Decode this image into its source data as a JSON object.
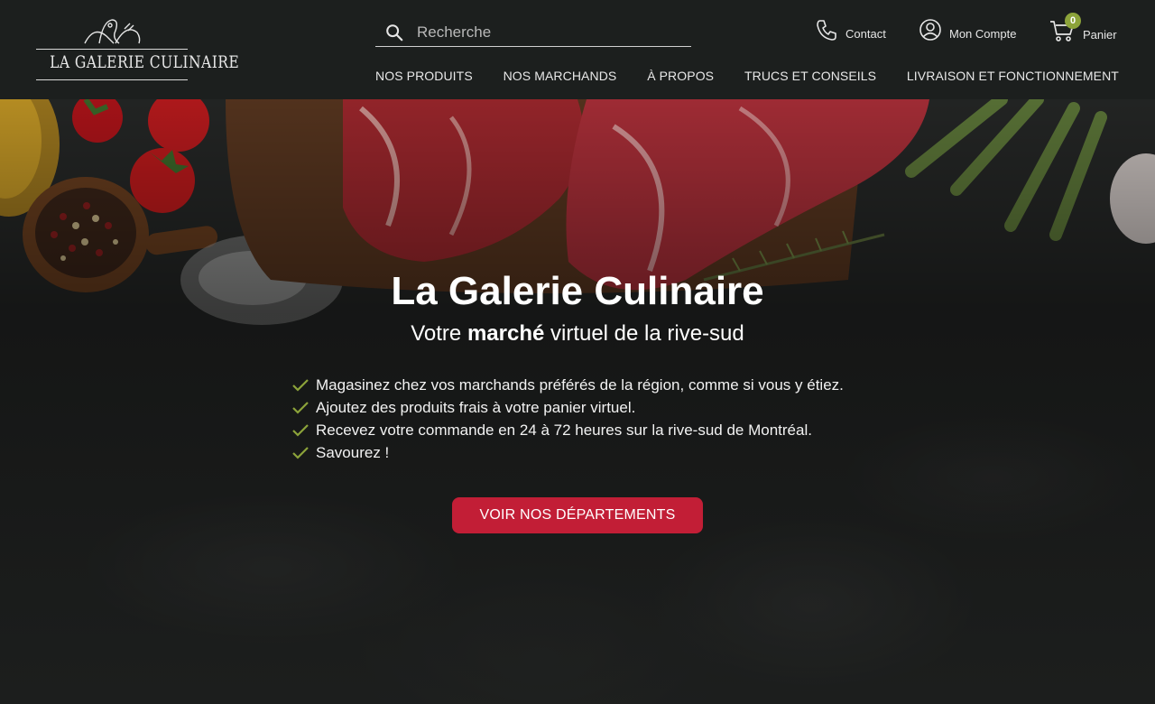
{
  "brand": {
    "logo_text": "LA GALERIE CULINAIRE"
  },
  "search": {
    "placeholder": "Recherche",
    "icon": "search-icon"
  },
  "utility": {
    "contact_label": "Contact",
    "account_label": "Mon Compte",
    "cart_label": "Panier",
    "cart_count": "0"
  },
  "nav": {
    "items": [
      {
        "label": "NOS PRODUITS"
      },
      {
        "label": "NOS MARCHANDS"
      },
      {
        "label": "À PROPOS"
      },
      {
        "label": "TRUCS ET CONSEILS"
      },
      {
        "label": "LIVRAISON ET FONCTIONNEMENT"
      }
    ]
  },
  "hero": {
    "title": "La Galerie Culinaire",
    "subtitle_pre": "Votre ",
    "subtitle_bold": "marché",
    "subtitle_post": " virtuel de la rive-sud",
    "features": [
      "Magasinez chez vos marchands préférés de la région, comme si vous y étiez.",
      "Ajoutez des produits frais à votre panier virtuel.",
      "Recevez votre commande en 24 à 72 heures sur la rive-sud de Montréal.",
      "Savourez !"
    ],
    "cta_label": "VOIR NOS DÉPARTEMENTS"
  },
  "colors": {
    "header_bg": "#1c1f1e",
    "accent_red": "#c21e36",
    "accent_green": "#8ca33a"
  }
}
